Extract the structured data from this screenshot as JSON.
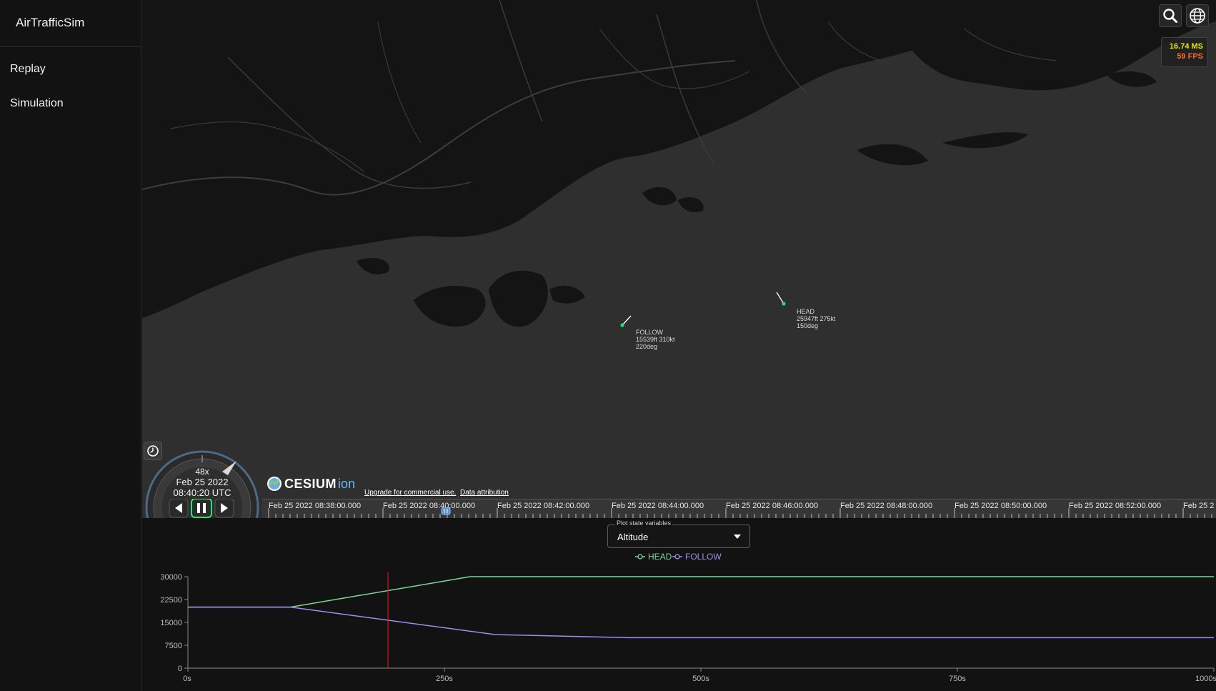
{
  "app": {
    "title": "AirTrafficSim"
  },
  "sidebar": {
    "items": [
      {
        "label": "Replay"
      },
      {
        "label": "Simulation"
      }
    ]
  },
  "toolbar": {
    "search_icon": "search-icon",
    "globe_icon": "globe-icon"
  },
  "perf": {
    "ms": "16.74 MS",
    "fps": "59 FPS"
  },
  "aircraft": [
    {
      "callsign": "FOLLOW",
      "line2": "15539ft 310kt",
      "line3": "220deg"
    },
    {
      "callsign": "HEAD",
      "line2": "25947ft 275kt",
      "line3": "150deg"
    }
  ],
  "clock": {
    "speed": "48x",
    "date": "Feb 25 2022",
    "time": "08:40:20 UTC"
  },
  "credits": {
    "logo_word": "CESIUM",
    "logo_suffix": "ion",
    "upgrade": "Upgrade for commercial use.",
    "attribution": "Data attribution"
  },
  "timeline": {
    "labels": [
      "Feb 25 2022 08:38:00.000",
      "Feb 25 2022 08:40:00.000",
      "Feb 25 2022 08:42:00.000",
      "Feb 25 2022 08:44:00.000",
      "Feb 25 2022 08:46:00.000",
      "Feb 25 2022 08:48:00.000",
      "Feb 25 2022 08:50:00.000",
      "Feb 25 2022 08:52:00.000",
      "Feb 25 2"
    ]
  },
  "plot_select": {
    "legend": "Plot state variables",
    "value": "Altitude"
  },
  "colors": {
    "head": "#7fd69a",
    "follow": "#9b8ff0",
    "cursor": "#d01818",
    "aircraft_dot": "#19e36b"
  },
  "chart_data": {
    "type": "line",
    "xlabel": "",
    "ylabel": "",
    "x_ticks": [
      "0s",
      "250s",
      "500s",
      "750s",
      "1000s"
    ],
    "y_ticks": [
      "0",
      "7500",
      "15000",
      "22500",
      "30000"
    ],
    "xlim": [
      0,
      1000
    ],
    "ylim": [
      0,
      30000
    ],
    "current_time": 195,
    "legend_position": "top-center",
    "series": [
      {
        "name": "HEAD",
        "x": [
          0,
          100,
          275,
          1000
        ],
        "y": [
          20000,
          20000,
          30000,
          30000
        ]
      },
      {
        "name": "FOLLOW",
        "x": [
          0,
          100,
          300,
          430,
          1000
        ],
        "y": [
          20000,
          20000,
          11000,
          10000,
          10000
        ]
      }
    ]
  }
}
